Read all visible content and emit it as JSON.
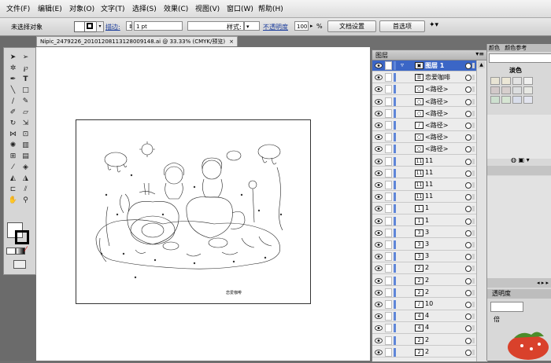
{
  "menubar": {
    "items": [
      "文件(F)",
      "编辑(E)",
      "对象(O)",
      "文字(T)",
      "选择(S)",
      "效果(C)",
      "视图(V)",
      "窗口(W)",
      "帮助(H)"
    ]
  },
  "control_bar": {
    "selection_status": "未选择对象",
    "stroke_label": "描边:",
    "stroke_weight": "1 pt",
    "style_label": "样式:",
    "opacity_label": "不透明度",
    "opacity_value": "100",
    "opacity_unit": "%",
    "doc_setup_button": "文档设置",
    "preferences_button": "首选项"
  },
  "document": {
    "tab_title": "Nipic_2479226_20101208113128009148.ai @ 33.33% (CMYK/预览)",
    "tab_close": "×",
    "caption": "恋爱咖啡"
  },
  "layers_panel": {
    "title": "图层",
    "rows": [
      {
        "name": "图层 1",
        "thumb": "▣",
        "selected": true
      },
      {
        "name": "恋爱咖啡",
        "thumb": "☰"
      },
      {
        "name": "<路径>",
        "thumb": "○"
      },
      {
        "name": "<路径>",
        "thumb": "○"
      },
      {
        "name": "<路径>",
        "thumb": "○"
      },
      {
        "name": "<路径>",
        "thumb": "/"
      },
      {
        "name": "<路径>",
        "thumb": "○"
      },
      {
        "name": "<路径>",
        "thumb": "○"
      },
      {
        "name": "11",
        "thumb": "11"
      },
      {
        "name": "11",
        "thumb": "11"
      },
      {
        "name": "11",
        "thumb": "11"
      },
      {
        "name": "11",
        "thumb": "11"
      },
      {
        "name": "1",
        "thumb": "1"
      },
      {
        "name": "1",
        "thumb": "1"
      },
      {
        "name": "3",
        "thumb": "3"
      },
      {
        "name": "3",
        "thumb": "3"
      },
      {
        "name": "3",
        "thumb": "3"
      },
      {
        "name": "2",
        "thumb": "2"
      },
      {
        "name": "2",
        "thumb": "2"
      },
      {
        "name": "2",
        "thumb": "2"
      },
      {
        "name": "10",
        "thumb": "♪"
      },
      {
        "name": "4",
        "thumb": "4"
      },
      {
        "name": "4",
        "thumb": "4"
      },
      {
        "name": "2",
        "thumb": "2"
      },
      {
        "name": "2",
        "thumb": "2"
      }
    ]
  },
  "right_panel": {
    "tab1": "颜色",
    "tab2": "颜色参考",
    "group_label": "淡色",
    "transparency_label": "透明度",
    "multiply_fragment": "倍",
    "swatch_colors": [
      "#e8e4d4",
      "#ece7d6",
      "#e3e3e3",
      "#f0f0ef",
      "#d2c9c9",
      "#d7cfcd",
      "#dcdedf",
      "#e7e8e3",
      "#cde0cf",
      "#d6e5d3",
      "#d8ddea",
      "#e2e4ee"
    ]
  },
  "colors": {
    "layer_bar": "#5f86d8",
    "layer_selected": "#3b66c6"
  }
}
